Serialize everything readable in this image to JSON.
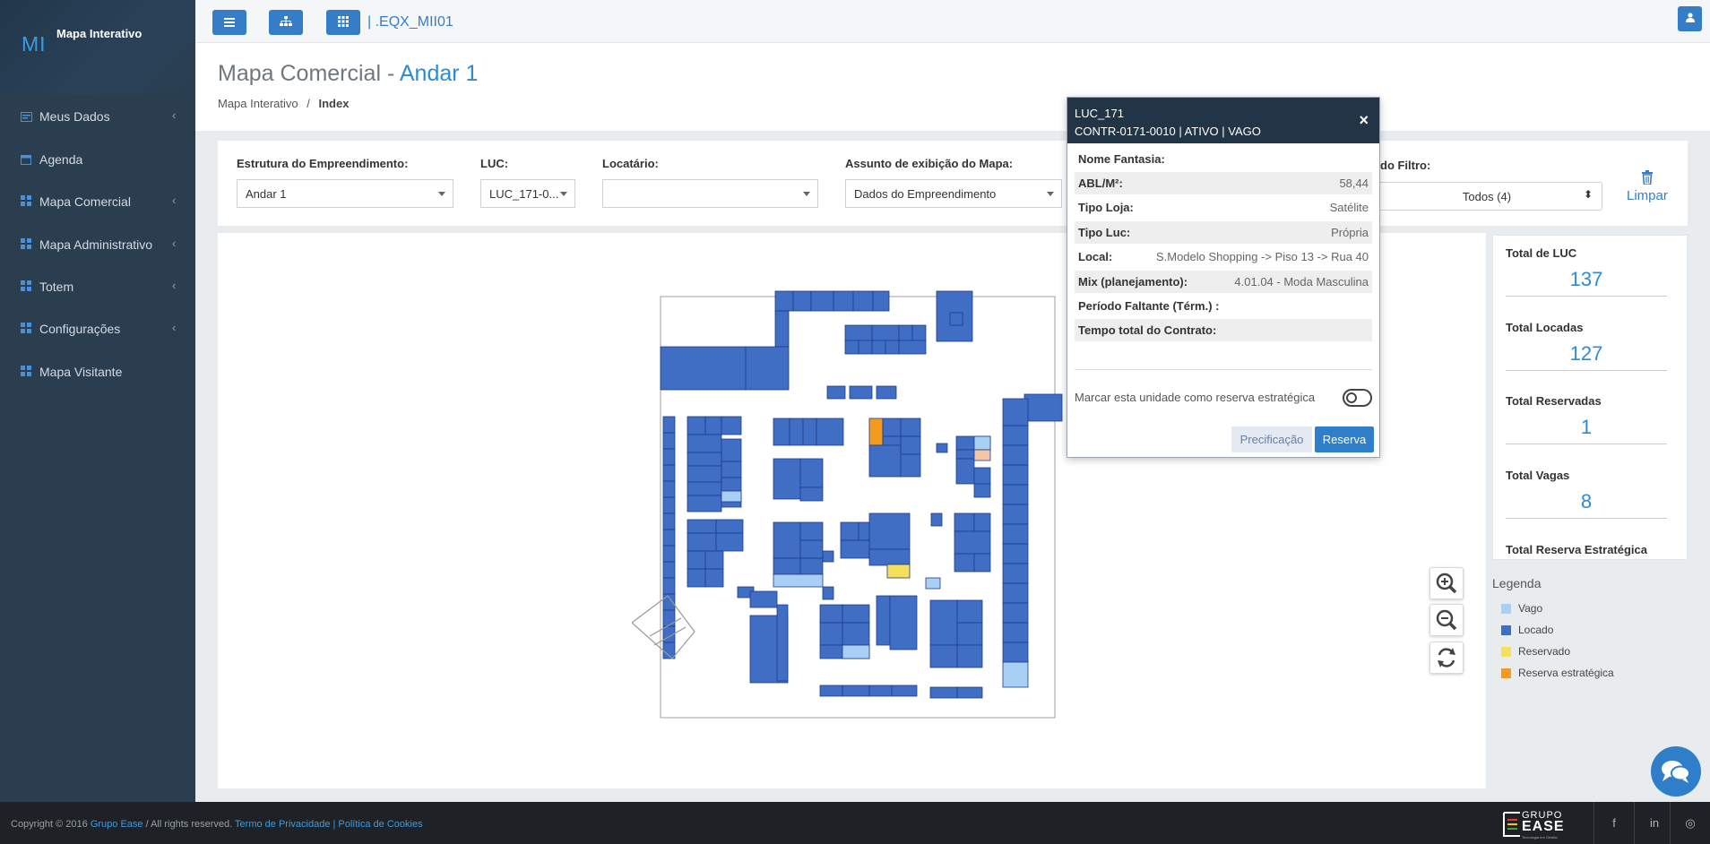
{
  "sidebar": {
    "logo": "MI",
    "app_name": "Mapa Interativo",
    "items": [
      {
        "label": "Meus Dados",
        "icon": "card-icon",
        "chevron": "‹"
      },
      {
        "label": "Agenda",
        "icon": "calendar-icon",
        "chevron": ""
      },
      {
        "label": "Mapa Comercial",
        "icon": "grid-icon",
        "chevron": "‹"
      },
      {
        "label": "Mapa Administrativo",
        "icon": "grid-icon",
        "chevron": "‹"
      },
      {
        "label": "Totem",
        "icon": "grid-icon",
        "chevron": "‹"
      },
      {
        "label": "Configurações",
        "icon": "grid-icon",
        "chevron": "‹"
      },
      {
        "label": "Mapa Visitante",
        "icon": "grid-icon",
        "chevron": ""
      }
    ]
  },
  "topbar": {
    "menu_icon": "hamburger-icon",
    "sitemap_icon": "sitemap-icon",
    "apps_icon": "apps-grid-icon",
    "map_code": "| .EQX_MII01",
    "user_icon": "user-icon"
  },
  "header": {
    "title_main": "Mapa Comercial - ",
    "title_accent": "Andar 1",
    "breadcrumb_root": "Mapa Interativo",
    "breadcrumb_sep": "/",
    "breadcrumb_current": "Index"
  },
  "filters": {
    "estrutura_label": "Estrutura do Empreendimento:",
    "estrutura_value": "Andar 1",
    "luc_label": "LUC:",
    "luc_value": "LUC_171-0...",
    "locatario_label": "Locatário:",
    "locatario_value": "",
    "assunto_label": "Assunto de exibição do Mapa:",
    "assunto_value": "Dados do Empreendimento",
    "filtro_label": "do Filtro:",
    "filtro_value": "Todos (4)",
    "limpar_label": "Limpar"
  },
  "stats": [
    {
      "label": "Total de LUC",
      "value": "137"
    },
    {
      "label": "Total Locadas",
      "value": "127"
    },
    {
      "label": "Total Reservadas",
      "value": "1"
    },
    {
      "label": "Total Vagas",
      "value": "8"
    },
    {
      "label": "Total Reserva Estratégica",
      "value": ""
    }
  ],
  "legend": {
    "title": "Legenda",
    "items": [
      {
        "label": "Vago",
        "color": "#a8d0f5"
      },
      {
        "label": "Locado",
        "color": "#3f6ec4"
      },
      {
        "label": "Reservado",
        "color": "#f6e05a"
      },
      {
        "label": "Reserva estratégica",
        "color": "#f39a1f"
      }
    ]
  },
  "popup": {
    "title": "LUC_171",
    "subtitle": "CONTR-0171-0010 | ATIVO | VAGO",
    "close": "×",
    "rows": [
      {
        "key": "Nome Fantasia:",
        "value": ""
      },
      {
        "key": "ABL/M²:",
        "value": "58,44"
      },
      {
        "key": "Tipo Loja:",
        "value": "Satélite"
      },
      {
        "key": "Tipo Luc:",
        "value": "Própria"
      },
      {
        "key": "Local:",
        "value": "S.Modelo Shopping -> Piso 13 -> Rua 40"
      },
      {
        "key": "Mix (planejamento):",
        "value": "4.01.04 - Moda Masculina"
      },
      {
        "key": "Período Faltante (Térm.) :",
        "value": ""
      },
      {
        "key": "Tempo total do Contrato:",
        "value": ""
      }
    ],
    "toggle_label": "Marcar esta unidade como reserva estratégica",
    "btn_precificacao": "Precificação",
    "btn_reserva": "Reserva"
  },
  "footer": {
    "copyright": "Copyright © 2016 ",
    "company": "Grupo Ease",
    "rights": " / All rights reserved. ",
    "privacy": "Termo de Privacidade | Política de Cookies",
    "brand_top": "GRUPO",
    "brand_bottom": "EASE",
    "brand_tagline": "Tecnologia em Gestão",
    "social": [
      "f",
      "in",
      "◎"
    ]
  },
  "map": {
    "colors": {
      "locado": "#3f6ec4",
      "vago": "#a8d0f5",
      "reservado": "#f6e05a",
      "estrategica": "#f39a1f",
      "outline": "#1f3c88"
    }
  }
}
